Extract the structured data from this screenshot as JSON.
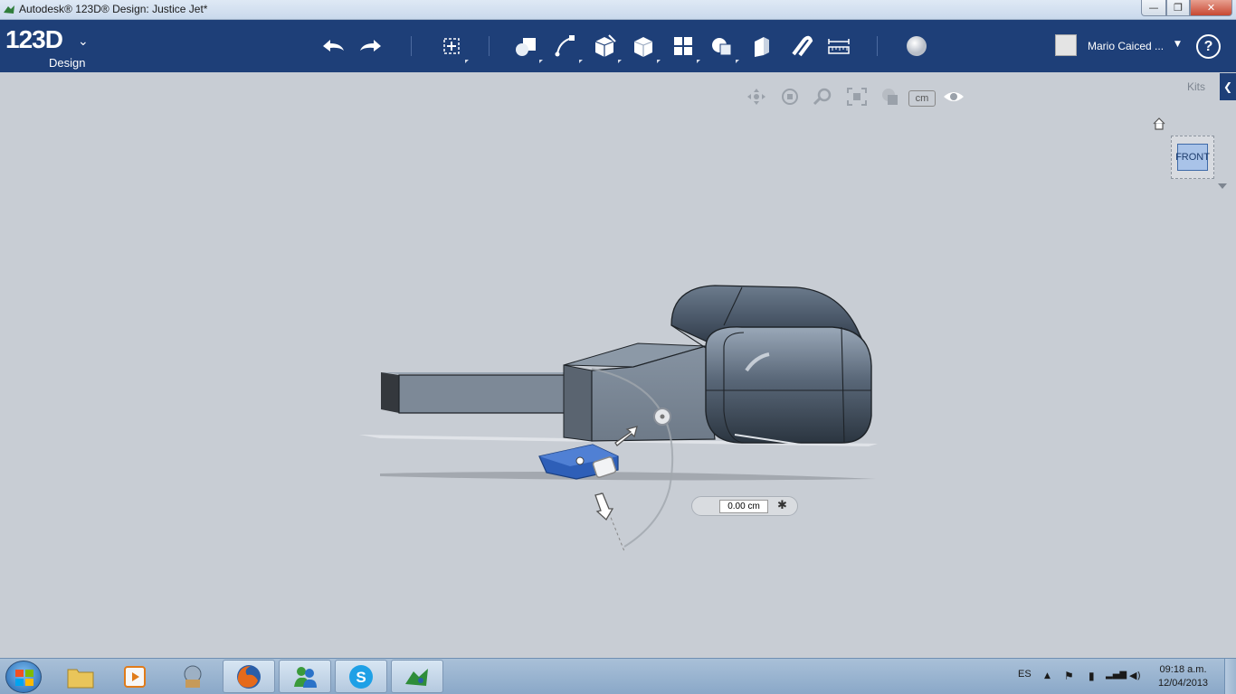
{
  "window": {
    "title": "Autodesk® 123D® Design: Justice Jet*",
    "min_label": "—",
    "max_label": "❐",
    "close_label": "✕"
  },
  "appbar": {
    "logo_big": "123D",
    "logo_small": "Design",
    "logo_chevron": "⌄",
    "user_name": "Mario Caiced ...",
    "user_caret": "▼",
    "help_label": "?"
  },
  "tools": [
    {
      "name": "undo-icon"
    },
    {
      "name": "redo-icon"
    },
    {
      "name": "transform-icon"
    },
    {
      "name": "primitives-icon"
    },
    {
      "name": "sketch-icon"
    },
    {
      "name": "construct-icon"
    },
    {
      "name": "modify-icon"
    },
    {
      "name": "pattern-icon"
    },
    {
      "name": "grouping-icon"
    },
    {
      "name": "combine-icon"
    },
    {
      "name": "snap-icon"
    },
    {
      "name": "measure-icon"
    },
    {
      "name": "material-icon"
    }
  ],
  "viewport": {
    "units_label": "cm",
    "kits_label": "Kits",
    "kits_tab_glyph": "❮",
    "viewcube_face": "FRONT",
    "dimension_value": "0.00 cm",
    "reset_glyph": "✱"
  },
  "taskbar": {
    "language": "ES",
    "time": "09:18 a.m.",
    "date": "12/04/2013",
    "tray_arrow": "▲",
    "flag_glyph": "⚑",
    "battery_glyph": "▮",
    "signal_glyph": "▂▄▆",
    "volume_glyph": "◀)"
  },
  "colors": {
    "appbar": "#1e3f78",
    "viewport": "#c8cdd4",
    "body_gray": "#7a8694",
    "cockpit": "#4b5868",
    "selected_part": "#2e5fb8"
  }
}
